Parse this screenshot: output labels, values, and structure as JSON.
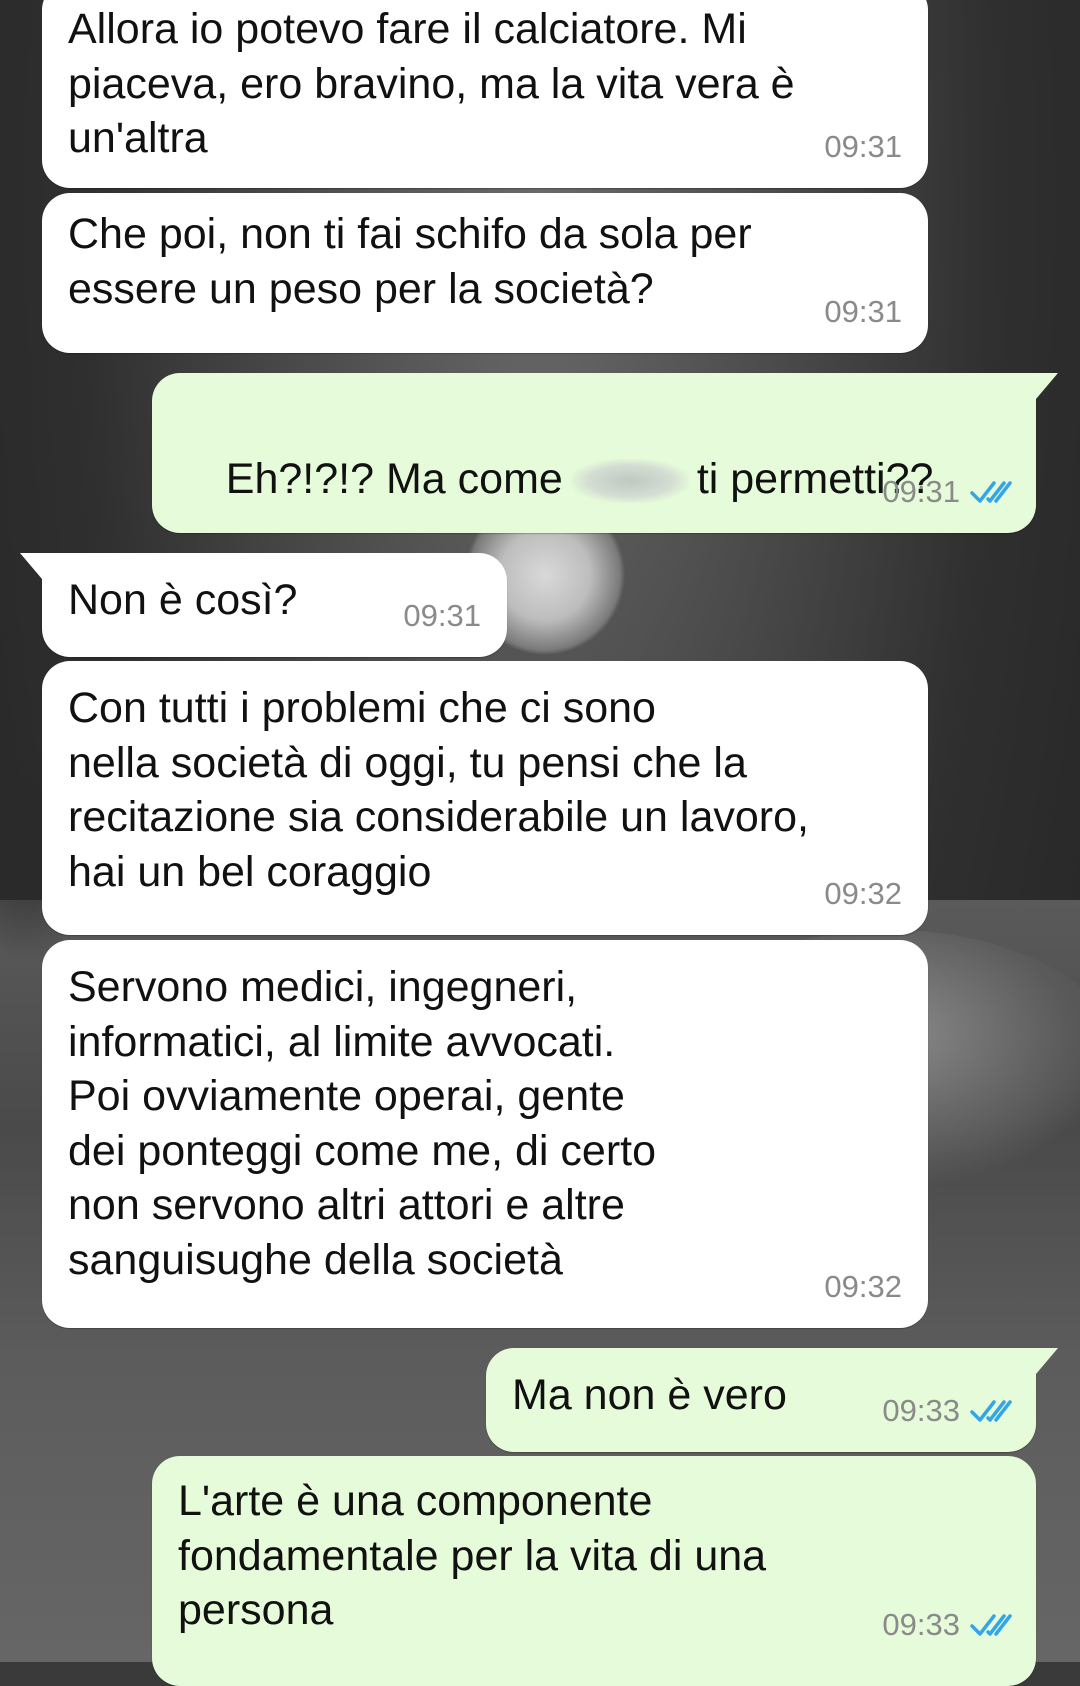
{
  "messages": [
    {
      "direction": "in",
      "text": "Allora io potevo fare il calciatore. Mi\npiaceva, ero bravino, ma la vita vera è\nun'altra",
      "time": "09:31"
    },
    {
      "direction": "in",
      "text": "Che poi, non ti fai schifo da sola per\nessere un peso per la società?",
      "time": "09:31"
    },
    {
      "direction": "out",
      "text_before": "Eh?!?!? Ma come",
      "redacted": true,
      "text_after": "ti permetti??",
      "time": "09:31",
      "status": "read"
    },
    {
      "direction": "in",
      "text": "Non è così?",
      "time": "09:31"
    },
    {
      "direction": "in",
      "text": "Con tutti i problemi che ci sono\nnella società di oggi, tu pensi che la\nrecitazione sia considerabile un lavoro,\nhai un bel coraggio",
      "time": "09:32"
    },
    {
      "direction": "in",
      "text": "Servono medici, ingegneri,\ninformatici, al limite avvocati.\nPoi ovviamente operai, gente\ndei ponteggi come me, di certo\nnon servono altri attori e altre\nsanguisughe della società",
      "time": "09:32"
    },
    {
      "direction": "out",
      "text": "Ma non è vero",
      "time": "09:33",
      "status": "read"
    },
    {
      "direction": "out",
      "text": "L'arte è una componente\nfondamentale per la vita di una\npersona",
      "time": "09:33",
      "status": "read"
    }
  ],
  "colors": {
    "incoming_bubble": "#ffffff",
    "outgoing_bubble": "#e6fbd9",
    "timestamp": "#8a8a8a",
    "read_ticks": "#34a5e8"
  },
  "icons": {
    "read_receipt": "double-check-icon"
  }
}
